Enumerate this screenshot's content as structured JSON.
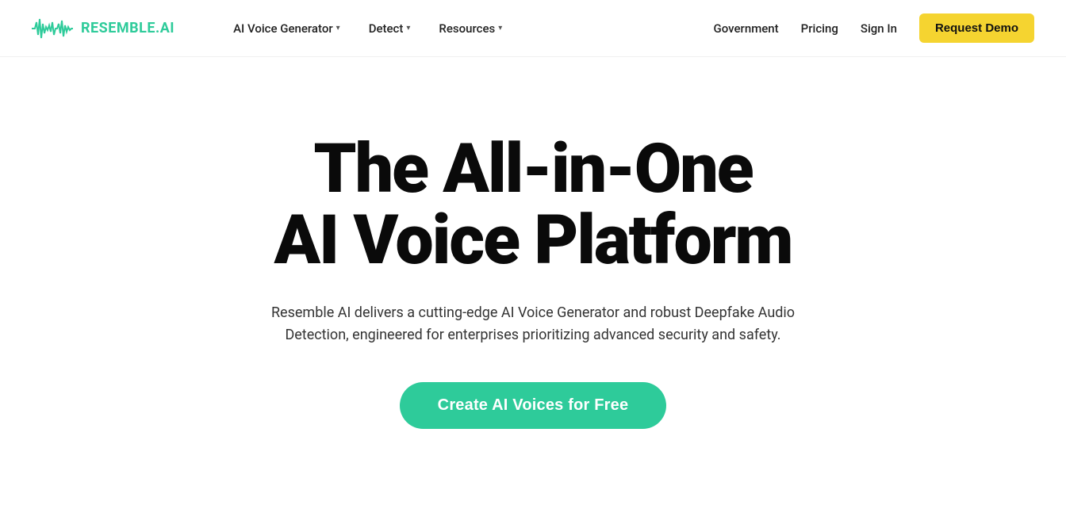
{
  "nav": {
    "logo_text": "RESEMBLE.AI",
    "items": [
      {
        "label": "AI Voice Generator",
        "has_dropdown": true
      },
      {
        "label": "Detect",
        "has_dropdown": true
      },
      {
        "label": "Resources",
        "has_dropdown": true
      }
    ],
    "right_links": [
      {
        "label": "Government"
      },
      {
        "label": "Pricing"
      },
      {
        "label": "Sign In"
      }
    ],
    "cta_label": "Request Demo"
  },
  "hero": {
    "title_line1": "The All-in-One",
    "title_line2": "AI Voice Platform",
    "subtitle": "Resemble AI delivers a cutting-edge AI Voice Generator and robust Deepfake Audio Detection, engineered for enterprises prioritizing advanced security and safety.",
    "cta_label": "Create AI Voices for Free"
  },
  "colors": {
    "brand_green": "#2ecb9a",
    "brand_yellow": "#f5d430",
    "text_dark": "#0a0a0a",
    "text_body": "#333333"
  }
}
